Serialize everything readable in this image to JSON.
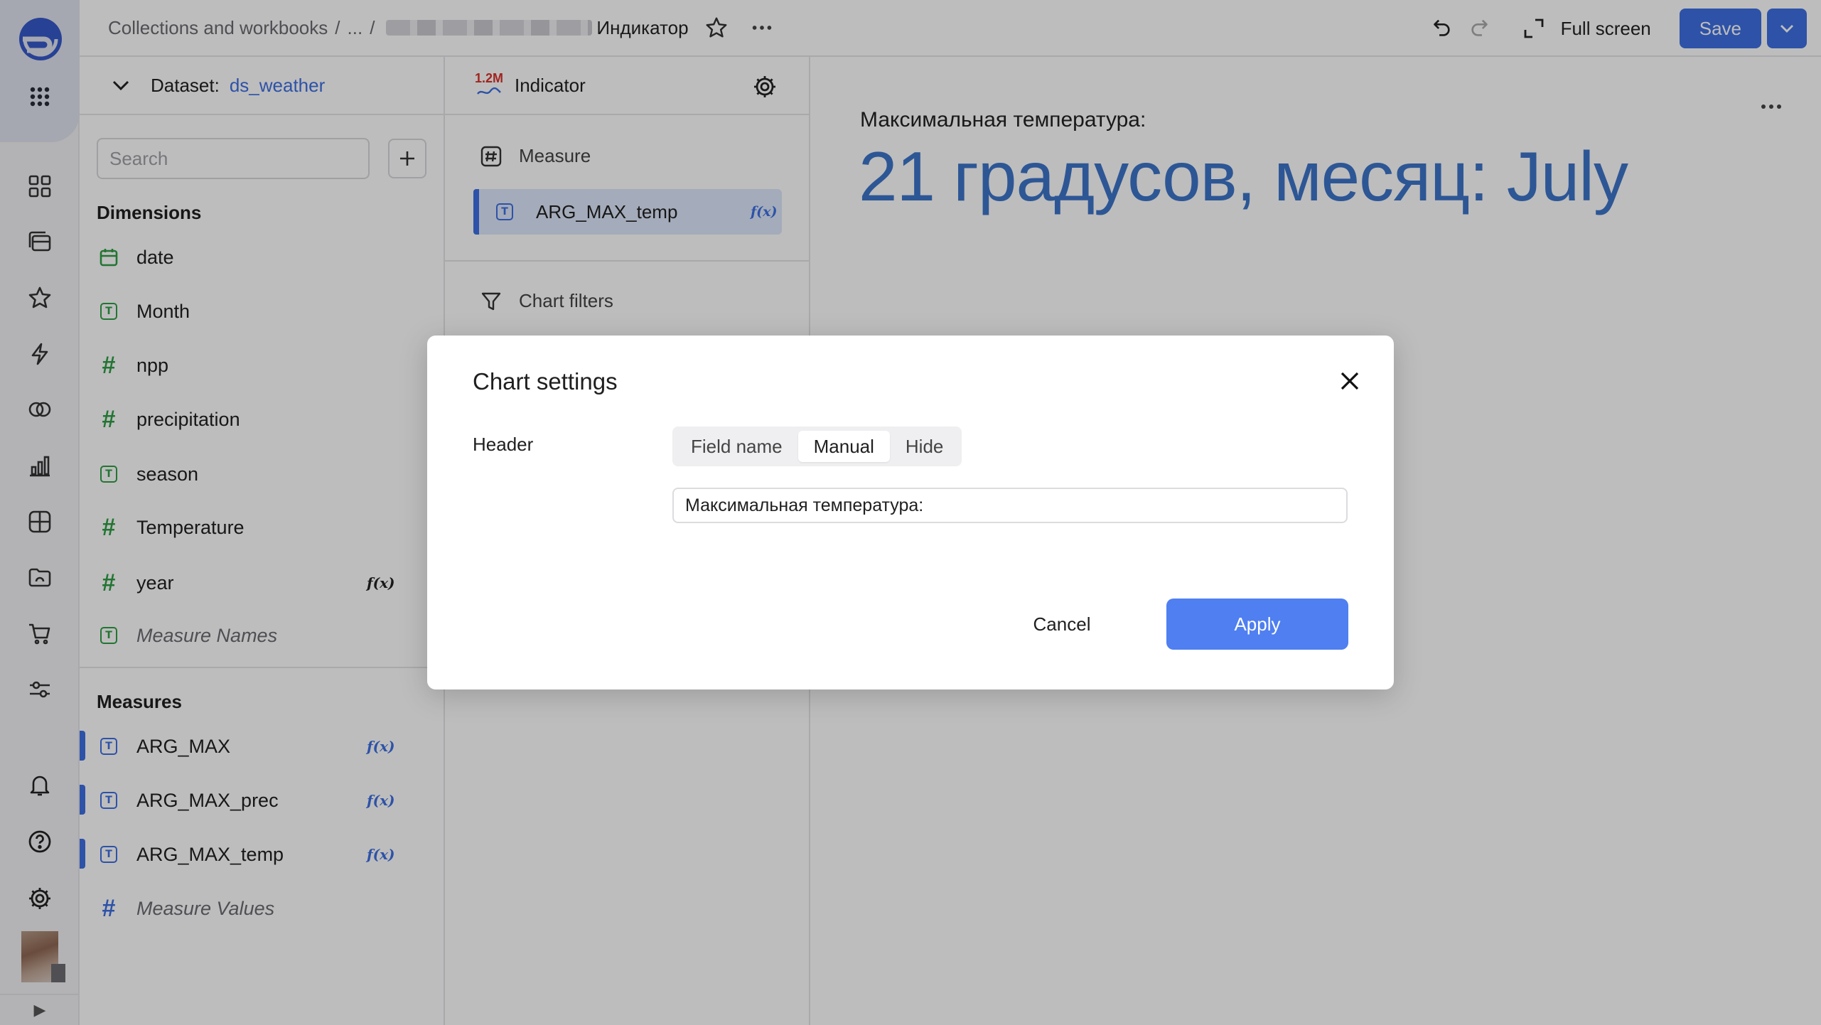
{
  "breadcrumb": {
    "root": "Collections and workbooks",
    "ellipsis": "...",
    "current": "Индикатор"
  },
  "toolbar": {
    "fullscreen_label": "Full screen",
    "save_label": "Save"
  },
  "dataset": {
    "label": "Dataset:",
    "name": "ds_weather",
    "search_placeholder": "Search",
    "dimensions_title": "Dimensions",
    "dimensions": [
      {
        "label": "date",
        "type": "date"
      },
      {
        "label": "Month",
        "type": "string"
      },
      {
        "label": "npp",
        "type": "number"
      },
      {
        "label": "precipitation",
        "type": "number"
      },
      {
        "label": "season",
        "type": "string"
      },
      {
        "label": "Temperature",
        "type": "number"
      },
      {
        "label": "year",
        "type": "number",
        "formula": "f(x)"
      },
      {
        "label": "Measure Names",
        "type": "string"
      }
    ],
    "measures_title": "Measures",
    "measures": [
      {
        "label": "ARG_MAX",
        "type": "string",
        "formula": "f(x)"
      },
      {
        "label": "ARG_MAX_prec",
        "type": "string",
        "formula": "f(x)"
      },
      {
        "label": "ARG_MAX_temp",
        "type": "string",
        "formula": "f(x)"
      },
      {
        "label": "Measure Values",
        "type": "number"
      }
    ]
  },
  "visualization": {
    "icon_text": "1.2M",
    "type": "Indicator",
    "measure_section": "Measure",
    "measure_field": "ARG_MAX_temp",
    "measure_formula": "f(x)",
    "filters_section": "Chart filters"
  },
  "chart": {
    "title": "Максимальная температура:",
    "value": "21 градусов, месяц: July"
  },
  "dialog": {
    "title": "Chart settings",
    "header_label": "Header",
    "header_options": [
      "Field name",
      "Manual",
      "Hide"
    ],
    "header_selected": "Manual",
    "header_value": "Максимальная температура:",
    "cancel_label": "Cancel",
    "apply_label": "Apply"
  },
  "colors": {
    "accent": "#3d6fe3",
    "dimension": "#2f9e44",
    "measure": "#3d6fe3",
    "indicator_value": "#3d74c9"
  }
}
